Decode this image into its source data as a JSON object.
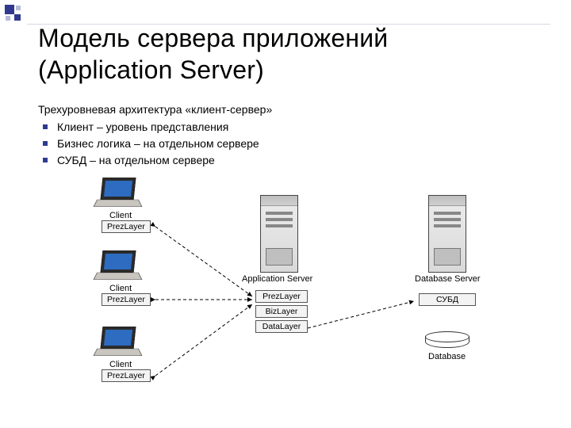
{
  "title_line1": "Модель сервера приложений",
  "title_line2": "(Application Server)",
  "intro": "Трехуровневая архитектура «клиент-сервер»",
  "bullets": [
    "Клиент – уровень представления",
    "Бизнес логика – на отдельном сервере",
    "СУБД – на отдельном сервере"
  ],
  "diagram": {
    "client_label": "Client",
    "prez_label": "PrezLayer",
    "app_server_label": "Application Server",
    "app_layers": {
      "prez": "PrezLayer",
      "biz": "BizLayer",
      "data": "DataLayer"
    },
    "db_server_label": "Database Server",
    "dbms_label": "СУБД",
    "database_label": "Database"
  }
}
